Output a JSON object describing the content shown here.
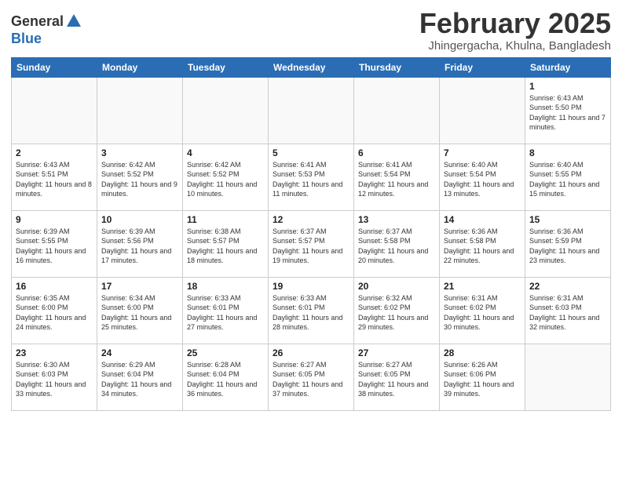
{
  "logo": {
    "general": "General",
    "blue": "Blue"
  },
  "title": {
    "month": "February 2025",
    "location": "Jhingergacha, Khulna, Bangladesh"
  },
  "weekdays": [
    "Sunday",
    "Monday",
    "Tuesday",
    "Wednesday",
    "Thursday",
    "Friday",
    "Saturday"
  ],
  "weeks": [
    [
      {
        "day": "",
        "info": ""
      },
      {
        "day": "",
        "info": ""
      },
      {
        "day": "",
        "info": ""
      },
      {
        "day": "",
        "info": ""
      },
      {
        "day": "",
        "info": ""
      },
      {
        "day": "",
        "info": ""
      },
      {
        "day": "1",
        "info": "Sunrise: 6:43 AM\nSunset: 5:50 PM\nDaylight: 11 hours and 7 minutes."
      }
    ],
    [
      {
        "day": "2",
        "info": "Sunrise: 6:43 AM\nSunset: 5:51 PM\nDaylight: 11 hours and 8 minutes."
      },
      {
        "day": "3",
        "info": "Sunrise: 6:42 AM\nSunset: 5:52 PM\nDaylight: 11 hours and 9 minutes."
      },
      {
        "day": "4",
        "info": "Sunrise: 6:42 AM\nSunset: 5:52 PM\nDaylight: 11 hours and 10 minutes."
      },
      {
        "day": "5",
        "info": "Sunrise: 6:41 AM\nSunset: 5:53 PM\nDaylight: 11 hours and 11 minutes."
      },
      {
        "day": "6",
        "info": "Sunrise: 6:41 AM\nSunset: 5:54 PM\nDaylight: 11 hours and 12 minutes."
      },
      {
        "day": "7",
        "info": "Sunrise: 6:40 AM\nSunset: 5:54 PM\nDaylight: 11 hours and 13 minutes."
      },
      {
        "day": "8",
        "info": "Sunrise: 6:40 AM\nSunset: 5:55 PM\nDaylight: 11 hours and 15 minutes."
      }
    ],
    [
      {
        "day": "9",
        "info": "Sunrise: 6:39 AM\nSunset: 5:55 PM\nDaylight: 11 hours and 16 minutes."
      },
      {
        "day": "10",
        "info": "Sunrise: 6:39 AM\nSunset: 5:56 PM\nDaylight: 11 hours and 17 minutes."
      },
      {
        "day": "11",
        "info": "Sunrise: 6:38 AM\nSunset: 5:57 PM\nDaylight: 11 hours and 18 minutes."
      },
      {
        "day": "12",
        "info": "Sunrise: 6:37 AM\nSunset: 5:57 PM\nDaylight: 11 hours and 19 minutes."
      },
      {
        "day": "13",
        "info": "Sunrise: 6:37 AM\nSunset: 5:58 PM\nDaylight: 11 hours and 20 minutes."
      },
      {
        "day": "14",
        "info": "Sunrise: 6:36 AM\nSunset: 5:58 PM\nDaylight: 11 hours and 22 minutes."
      },
      {
        "day": "15",
        "info": "Sunrise: 6:36 AM\nSunset: 5:59 PM\nDaylight: 11 hours and 23 minutes."
      }
    ],
    [
      {
        "day": "16",
        "info": "Sunrise: 6:35 AM\nSunset: 6:00 PM\nDaylight: 11 hours and 24 minutes."
      },
      {
        "day": "17",
        "info": "Sunrise: 6:34 AM\nSunset: 6:00 PM\nDaylight: 11 hours and 25 minutes."
      },
      {
        "day": "18",
        "info": "Sunrise: 6:33 AM\nSunset: 6:01 PM\nDaylight: 11 hours and 27 minutes."
      },
      {
        "day": "19",
        "info": "Sunrise: 6:33 AM\nSunset: 6:01 PM\nDaylight: 11 hours and 28 minutes."
      },
      {
        "day": "20",
        "info": "Sunrise: 6:32 AM\nSunset: 6:02 PM\nDaylight: 11 hours and 29 minutes."
      },
      {
        "day": "21",
        "info": "Sunrise: 6:31 AM\nSunset: 6:02 PM\nDaylight: 11 hours and 30 minutes."
      },
      {
        "day": "22",
        "info": "Sunrise: 6:31 AM\nSunset: 6:03 PM\nDaylight: 11 hours and 32 minutes."
      }
    ],
    [
      {
        "day": "23",
        "info": "Sunrise: 6:30 AM\nSunset: 6:03 PM\nDaylight: 11 hours and 33 minutes."
      },
      {
        "day": "24",
        "info": "Sunrise: 6:29 AM\nSunset: 6:04 PM\nDaylight: 11 hours and 34 minutes."
      },
      {
        "day": "25",
        "info": "Sunrise: 6:28 AM\nSunset: 6:04 PM\nDaylight: 11 hours and 36 minutes."
      },
      {
        "day": "26",
        "info": "Sunrise: 6:27 AM\nSunset: 6:05 PM\nDaylight: 11 hours and 37 minutes."
      },
      {
        "day": "27",
        "info": "Sunrise: 6:27 AM\nSunset: 6:05 PM\nDaylight: 11 hours and 38 minutes."
      },
      {
        "day": "28",
        "info": "Sunrise: 6:26 AM\nSunset: 6:06 PM\nDaylight: 11 hours and 39 minutes."
      },
      {
        "day": "",
        "info": ""
      }
    ]
  ]
}
